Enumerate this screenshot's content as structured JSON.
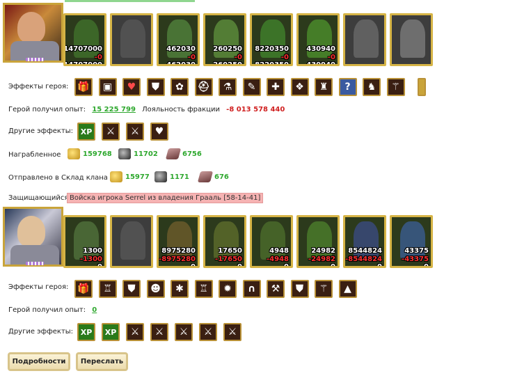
{
  "attacker": {
    "units": [
      {
        "top": "14707000",
        "mid": "-0",
        "bot": "14707000",
        "color": "#3f6e2a"
      },
      {
        "top": "",
        "mid": "",
        "bot": "",
        "color": "#555"
      },
      {
        "top": "462030",
        "mid": "-0",
        "bot": "462030",
        "color": "#4f7e3a"
      },
      {
        "top": "260250",
        "mid": "-0",
        "bot": "260250",
        "color": "#5a8a3a"
      },
      {
        "top": "8220350",
        "mid": "-0",
        "bot": "8220350",
        "color": "#3f7e2a"
      },
      {
        "top": "430940",
        "mid": "-0",
        "bot": "430940",
        "color": "#4a8a2a"
      },
      {
        "top": "",
        "mid": "",
        "bot": "",
        "color": "#666"
      },
      {
        "top": "",
        "mid": "",
        "bot": "",
        "color": "#777"
      }
    ],
    "effects_label": "Эффекты героя:",
    "effects_icons": [
      "gift-icon",
      "chest-icon",
      "heart-icon",
      "shield-icon",
      "flowers-icon",
      "helmet-icon",
      "potion-icon",
      "scroll-icon",
      "cross-icon",
      "ornament-icon",
      "cloak-icon",
      "question-icon",
      "dragon-icon",
      "staff-icon"
    ],
    "exp_label": "Герой получил опыт:",
    "exp_value": "15 225 799",
    "loyalty_label": "Лояльность фракции",
    "loyalty_value": "-8 013 578 440",
    "other_label": "Другие эффекты:",
    "other_icons": [
      "xp-icon",
      "sword-icon",
      "sword-icon",
      "heart-sword-icon"
    ],
    "xp_text": "ХР",
    "plundered_label": "Награбленное",
    "plundered": {
      "gold": "159768",
      "ore": "11702",
      "wood": "6756"
    },
    "clan_label": "Отправлено в Склад клана",
    "clan": {
      "gold": "15977",
      "ore": "1171",
      "wood": "676"
    }
  },
  "defender": {
    "label": "Защищающийся",
    "name": "Войска игрока Serrel из владения Грааль [58-14-41]",
    "units": [
      {
        "top": "1300",
        "mid": "-1300",
        "bot": "0",
        "color": "#4f6e3a"
      },
      {
        "top": "",
        "mid": "",
        "bot": "",
        "color": "#555"
      },
      {
        "top": "8975280",
        "mid": "-8975280",
        "bot": "0",
        "color": "#6a5a2a"
      },
      {
        "top": "17650",
        "mid": "-17650",
        "bot": "0",
        "color": "#5a6a2a"
      },
      {
        "top": "4948",
        "mid": "-4948",
        "bot": "0",
        "color": "#4a6a2a"
      },
      {
        "top": "24982",
        "mid": "-24982",
        "bot": "0",
        "color": "#4a7a2a"
      },
      {
        "top": "8544824",
        "mid": "-8544824",
        "bot": "0",
        "color": "#3a4a7a"
      },
      {
        "top": "43375",
        "mid": "-43375",
        "bot": "0",
        "color": "#3a5a8a"
      }
    ],
    "effects_label": "Эффекты героя:",
    "effects_icons": [
      "gift-icon",
      "helm-icon",
      "shield-icon",
      "head-icon",
      "crab-icon",
      "armor-icon",
      "flame-icon",
      "horseshoe-icon",
      "axe-icon",
      "shield-icon",
      "staff-icon",
      "robe-icon"
    ],
    "exp_label": "Герой получил опыт:",
    "exp_value": "0",
    "other_label": "Другие эффекты:",
    "other_icons": [
      "xp-icon",
      "xp-icon",
      "sword-icon",
      "sword-icon",
      "sword-icon",
      "sword-icon",
      "sword-icon"
    ],
    "xp_text": "ХР"
  },
  "buttons": {
    "details": "Подробности",
    "forward": "Переслать"
  },
  "colors": {
    "accent_green": "#2ea82e",
    "loss_red": "#d02020",
    "frame_gold": "#d6b446",
    "defender_bg": "#f6b3b3"
  }
}
